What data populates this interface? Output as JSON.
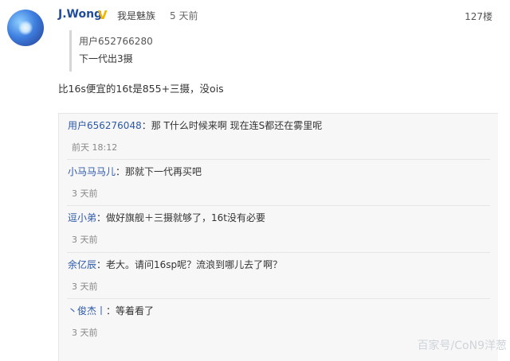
{
  "post": {
    "username": "J.Wong",
    "tag": "我是魅族",
    "time": "5 天前",
    "floor": "127楼",
    "quote": {
      "user": "用户652766280",
      "text": "下一代出3摄"
    },
    "text": "比16s便宜的16t是855+三摄，没ois"
  },
  "replies": [
    {
      "user": "用户656276048",
      "text": "：那 T什么时候来啊 现在连S都还在雾里呢",
      "time": "前天 18:12"
    },
    {
      "user": "小马马马儿",
      "text": "：那就下一代再买吧",
      "time": "3 天前"
    },
    {
      "user": "逗小弟",
      "text": "：做好旗舰＋三摄就够了，16t没有必要",
      "time": "3 天前"
    },
    {
      "user": "余亿辰",
      "text": "：老大。请问16sp呢？流浪到哪儿去了啊？",
      "time": "3 天前"
    },
    {
      "user": "丶俊杰丨",
      "text": "：等着看了",
      "time": "3 天前"
    }
  ],
  "watermark": "百家号/CoN9洋葱",
  "icons": {
    "badge": "verified-v-icon",
    "avatar": "avatar"
  },
  "colors": {
    "link": "#2d59a8",
    "username": "#1f4c9b",
    "badge": "#f2b600"
  }
}
